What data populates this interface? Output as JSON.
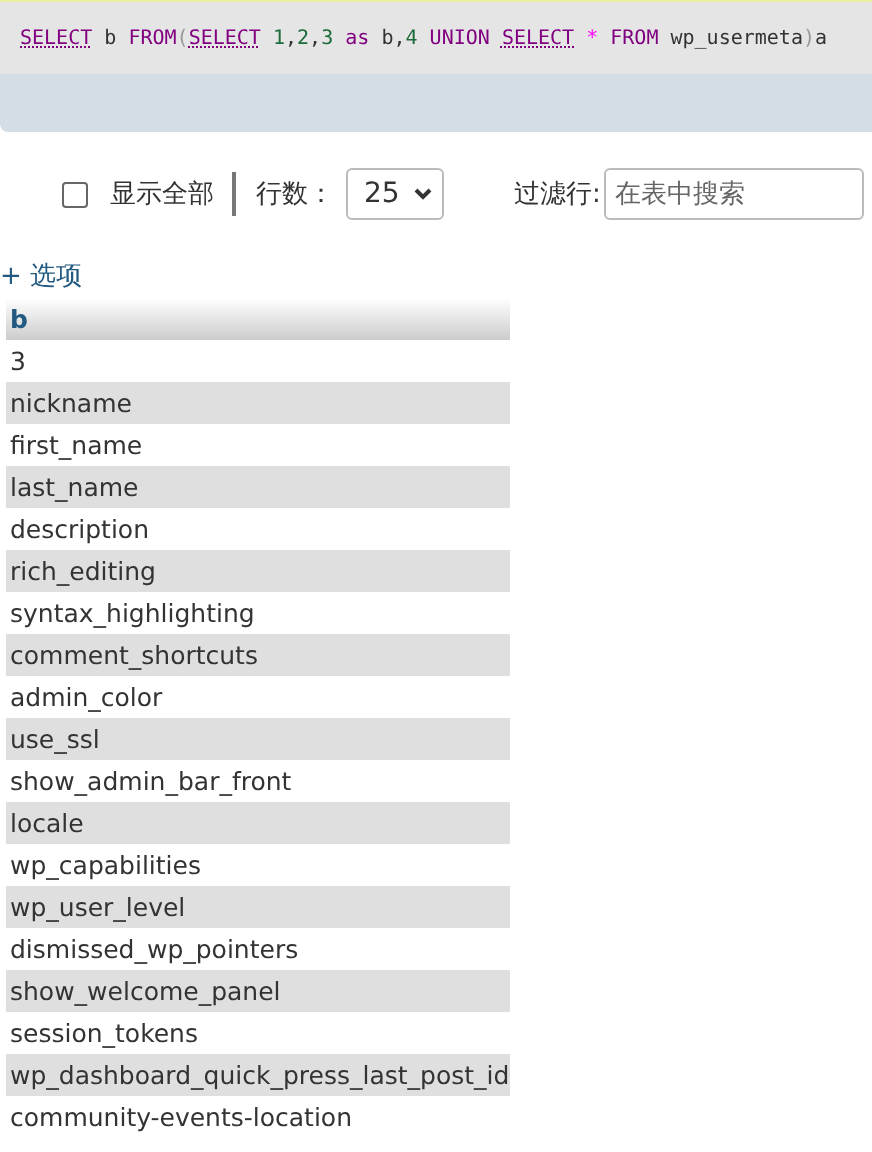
{
  "sql_query": [
    {
      "text": "SELECT",
      "kind": "function"
    },
    {
      "text": " b ",
      "kind": "plain"
    },
    {
      "text": "FROM",
      "kind": "keyword"
    },
    {
      "text": "(",
      "kind": "paren"
    },
    {
      "text": "SELECT",
      "kind": "function"
    },
    {
      "text": " 1",
      "kind": "number"
    },
    {
      "text": ",",
      "kind": "plain"
    },
    {
      "text": "2",
      "kind": "number"
    },
    {
      "text": ",",
      "kind": "plain"
    },
    {
      "text": "3",
      "kind": "number"
    },
    {
      "text": " as ",
      "kind": "keyword"
    },
    {
      "text": "b,",
      "kind": "plain"
    },
    {
      "text": "4",
      "kind": "number"
    },
    {
      "text": " UNION ",
      "kind": "keyword"
    },
    {
      "text": "SELECT",
      "kind": "function"
    },
    {
      "text": " *",
      "kind": "operator"
    },
    {
      "text": " FROM ",
      "kind": "keyword"
    },
    {
      "text": "wp_usermeta",
      "kind": "plain"
    },
    {
      "text": ")",
      "kind": "paren"
    },
    {
      "text": "a",
      "kind": "plain"
    }
  ],
  "controls": {
    "show_all": {
      "label": "显示全部",
      "checked": false
    },
    "rows_label": "行数：",
    "rows_value": "25",
    "filter_label": "过滤行:",
    "filter_placeholder": "在表中搜索"
  },
  "options_link": "+ 选项",
  "table": {
    "columns": [
      "b"
    ],
    "rows": [
      "3",
      "nickname",
      "first_name",
      "last_name",
      "description",
      "rich_editing",
      "syntax_highlighting",
      "comment_shortcuts",
      "admin_color",
      "use_ssl",
      "show_admin_bar_front",
      "locale",
      "wp_capabilities",
      "wp_user_level",
      "dismissed_wp_pointers",
      "show_welcome_panel",
      "session_tokens",
      "wp_dashboard_quick_press_last_post_id",
      "community-events-location"
    ]
  }
}
